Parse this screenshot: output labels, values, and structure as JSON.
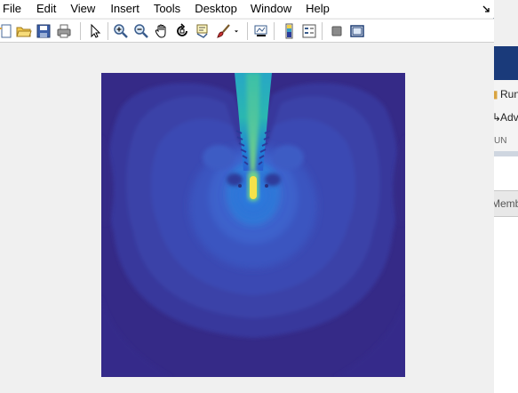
{
  "menu": {
    "file": "File",
    "edit": "Edit",
    "view": "View",
    "insert": "Insert",
    "tools": "Tools",
    "desktop": "Desktop",
    "window": "Window",
    "help": "Help"
  },
  "toolbar": {
    "buttons": [
      "new-figure",
      "open-file",
      "save",
      "print",
      "edit-plot",
      "zoom-in",
      "zoom-out",
      "pan",
      "rotate-3d",
      "data-cursor",
      "brush",
      "link-plot",
      "colorbar",
      "legend",
      "hide-plot-tools",
      "show-plot-tools"
    ]
  },
  "background_app": {
    "run_label": "Run",
    "advance_label": "Adv",
    "section_label": "UN",
    "members_label": "Memb"
  },
  "colors": {
    "background_dark": "#352a87",
    "field_mid": "#3a4bb4",
    "field_light": "#2f8fe0",
    "field_teal": "#2ab7b8",
    "field_peak": "#f5e24a"
  }
}
